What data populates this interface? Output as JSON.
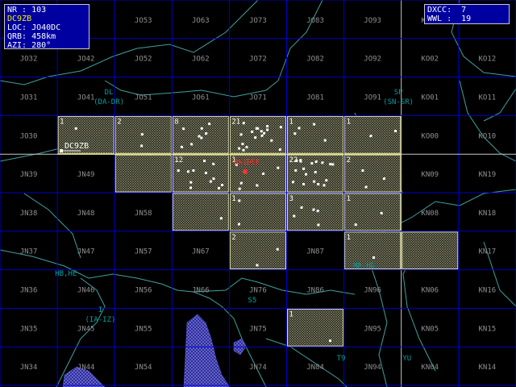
{
  "info_panel": {
    "nr": "NR : 103",
    "call": "DC9ZB",
    "loc": "LOC: JO40DC",
    "qrb": "QRB: 458km",
    "azi": "AZI: 280°"
  },
  "stats_panel": {
    "dxcc": "DXCC:  7",
    "wwl": "WWL :  19"
  },
  "station": {
    "call": "DC9ZB",
    "locator": "JO40"
  },
  "grid_labels": [
    {
      "label": "JO53",
      "col": 2,
      "row": 0
    },
    {
      "label": "JO63",
      "col": 3,
      "row": 0
    },
    {
      "label": "JO73",
      "col": 4,
      "row": 0
    },
    {
      "label": "JO83",
      "col": 5,
      "row": 0
    },
    {
      "label": "JO93",
      "col": 6,
      "row": 0
    },
    {
      "label": "KO03",
      "col": 7,
      "row": 0
    },
    {
      "label": "JO32",
      "col": 0,
      "row": 1
    },
    {
      "label": "JO42",
      "col": 1,
      "row": 1
    },
    {
      "label": "JO52",
      "col": 2,
      "row": 1
    },
    {
      "label": "JO62",
      "col": 3,
      "row": 1
    },
    {
      "label": "JO72",
      "col": 4,
      "row": 1
    },
    {
      "label": "JO82",
      "col": 5,
      "row": 1
    },
    {
      "label": "JO92",
      "col": 6,
      "row": 1
    },
    {
      "label": "KO02",
      "col": 7,
      "row": 1
    },
    {
      "label": "KO12",
      "col": 8,
      "row": 1
    },
    {
      "label": "JO31",
      "col": 0,
      "row": 2
    },
    {
      "label": "JO41",
      "col": 1,
      "row": 2
    },
    {
      "label": "JO51",
      "col": 2,
      "row": 2
    },
    {
      "label": "JO61",
      "col": 3,
      "row": 2
    },
    {
      "label": "JO71",
      "col": 4,
      "row": 2
    },
    {
      "label": "JO81",
      "col": 5,
      "row": 2
    },
    {
      "label": "JO91",
      "col": 6,
      "row": 2
    },
    {
      "label": "KO01",
      "col": 7,
      "row": 2
    },
    {
      "label": "KO11",
      "col": 8,
      "row": 2
    },
    {
      "label": "JO30",
      "col": 0,
      "row": 3
    },
    {
      "label": "KO00",
      "col": 7,
      "row": 3
    },
    {
      "label": "KO10",
      "col": 8,
      "row": 3
    },
    {
      "label": "JN39",
      "col": 0,
      "row": 4
    },
    {
      "label": "JN49",
      "col": 1,
      "row": 4
    },
    {
      "label": "KN09",
      "col": 7,
      "row": 4
    },
    {
      "label": "KN19",
      "col": 8,
      "row": 4
    },
    {
      "label": "JN38",
      "col": 0,
      "row": 5
    },
    {
      "label": "JN48",
      "col": 1,
      "row": 5
    },
    {
      "label": "JN58",
      "col": 2,
      "row": 5
    },
    {
      "label": "KN08",
      "col": 7,
      "row": 5
    },
    {
      "label": "KN18",
      "col": 8,
      "row": 5
    },
    {
      "label": "JN37",
      "col": 0,
      "row": 6
    },
    {
      "label": "JN47",
      "col": 1,
      "row": 6
    },
    {
      "label": "JN57",
      "col": 2,
      "row": 6
    },
    {
      "label": "JN67",
      "col": 3,
      "row": 6
    },
    {
      "label": "JN87",
      "col": 5,
      "row": 6
    },
    {
      "label": "KN17",
      "col": 8,
      "row": 6
    },
    {
      "label": "JN36",
      "col": 0,
      "row": 7
    },
    {
      "label": "JN46",
      "col": 1,
      "row": 7
    },
    {
      "label": "JN56",
      "col": 2,
      "row": 7
    },
    {
      "label": "JN66",
      "col": 3,
      "row": 7
    },
    {
      "label": "JN76",
      "col": 4,
      "row": 7
    },
    {
      "label": "JN86",
      "col": 5,
      "row": 7
    },
    {
      "label": "JN96",
      "col": 6,
      "row": 7
    },
    {
      "label": "KN06",
      "col": 7,
      "row": 7
    },
    {
      "label": "KN16",
      "col": 8,
      "row": 7
    },
    {
      "label": "JN35",
      "col": 0,
      "row": 8
    },
    {
      "label": "JN45",
      "col": 1,
      "row": 8
    },
    {
      "label": "JN55",
      "col": 2,
      "row": 8
    },
    {
      "label": "JN75",
      "col": 4,
      "row": 8
    },
    {
      "label": "JN95",
      "col": 6,
      "row": 8
    },
    {
      "label": "KN05",
      "col": 7,
      "row": 8
    },
    {
      "label": "KN15",
      "col": 8,
      "row": 8
    },
    {
      "label": "JN34",
      "col": 0,
      "row": 9
    },
    {
      "label": "JN44",
      "col": 1,
      "row": 9
    },
    {
      "label": "JN54",
      "col": 2,
      "row": 9
    },
    {
      "label": "JN74",
      "col": 4,
      "row": 9
    },
    {
      "label": "JN84",
      "col": 5,
      "row": 9
    },
    {
      "label": "JN94",
      "col": 6,
      "row": 9
    },
    {
      "label": "KN04",
      "col": 7,
      "row": 9
    },
    {
      "label": "KN14",
      "col": 8,
      "row": 9
    }
  ],
  "worked_squares": [
    {
      "col": 1,
      "row": 3,
      "count": "1"
    },
    {
      "col": 2,
      "row": 3,
      "count": "2"
    },
    {
      "col": 3,
      "row": 3,
      "count": "8"
    },
    {
      "col": 4,
      "row": 3,
      "count": "21"
    },
    {
      "col": 5,
      "row": 3,
      "count": "1"
    },
    {
      "col": 6,
      "row": 3,
      "count": "1"
    },
    {
      "col": 2,
      "row": 4,
      "count": ""
    },
    {
      "col": 3,
      "row": 4,
      "count": "12"
    },
    {
      "col": 4,
      "row": 4,
      "count": "1"
    },
    {
      "col": 5,
      "row": 4,
      "count": "22"
    },
    {
      "col": 6,
      "row": 4,
      "count": "2"
    },
    {
      "col": 3,
      "row": 5,
      "count": ""
    },
    {
      "col": 4,
      "row": 5,
      "count": "1"
    },
    {
      "col": 5,
      "row": 5,
      "count": "3"
    },
    {
      "col": 6,
      "row": 5,
      "count": "1"
    },
    {
      "col": 4,
      "row": 6,
      "count": "2"
    },
    {
      "col": 6,
      "row": 6,
      "count": "1"
    },
    {
      "col": 7,
      "row": 6,
      "count": ""
    },
    {
      "col": 5,
      "row": 8,
      "count": "1"
    }
  ],
  "country_labels": [
    {
      "text": "DL",
      "col": 1.9,
      "row": 2.45
    },
    {
      "text": "(DA-DR)",
      "col": 1.9,
      "row": 2.7
    },
    {
      "text": "SP",
      "col": 6.95,
      "row": 2.45
    },
    {
      "text": "(SN-SR)",
      "col": 6.95,
      "row": 2.7
    },
    {
      "text": "HB,HE",
      "col": 1.15,
      "row": 7.15
    },
    {
      "text": "I",
      "col": 1.75,
      "row": 8.1
    },
    {
      "text": "(IA-IZ)",
      "col": 1.75,
      "row": 8.35
    },
    {
      "text": "HA,HG",
      "col": 6.35,
      "row": 6.95
    },
    {
      "text": "S5",
      "col": 4.4,
      "row": 7.85
    },
    {
      "text": "T9",
      "col": 5.95,
      "row": 9.35
    },
    {
      "text": "YU",
      "col": 7.1,
      "row": 9.35
    }
  ],
  "target": {
    "label": "OK1DSF",
    "col": 4.3,
    "row": 4.15
  },
  "colors": {
    "grid": "#0000c8",
    "grid_major": "#c8c8c8",
    "square_fill": "#a0a080",
    "square_border": "#e0e0a0",
    "coast": "#40a0a0",
    "station_marker": "#ffffff",
    "country_label": "#00a0a0",
    "target": "#ff3030",
    "sea": "#6060e0"
  }
}
